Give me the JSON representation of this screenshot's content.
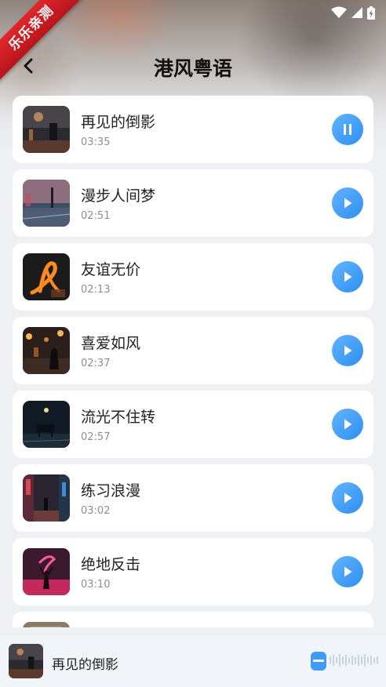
{
  "brand_ribbon": {
    "text": "乐乐亲测",
    "color": "#d71e25"
  },
  "header": {
    "title": "港风粤语",
    "back_icon": "chevron-left-icon"
  },
  "colors": {
    "accent": "#3f9bf6",
    "card_bg": "#ffffff",
    "page_bg": "#eef0f4"
  },
  "songs": [
    {
      "title": "再见的倒影",
      "duration": "03:35",
      "state": "pause"
    },
    {
      "title": "漫步人间梦",
      "duration": "02:51",
      "state": "play"
    },
    {
      "title": "友谊无价",
      "duration": "02:13",
      "state": "play"
    },
    {
      "title": "喜爱如风",
      "duration": "02:37",
      "state": "play"
    },
    {
      "title": "流光不住转",
      "duration": "02:57",
      "state": "play"
    },
    {
      "title": "练习浪漫",
      "duration": "03:02",
      "state": "play"
    },
    {
      "title": "绝地反击",
      "duration": "03:10",
      "state": "play"
    }
  ],
  "now_playing": {
    "title": "再见的倒影"
  }
}
